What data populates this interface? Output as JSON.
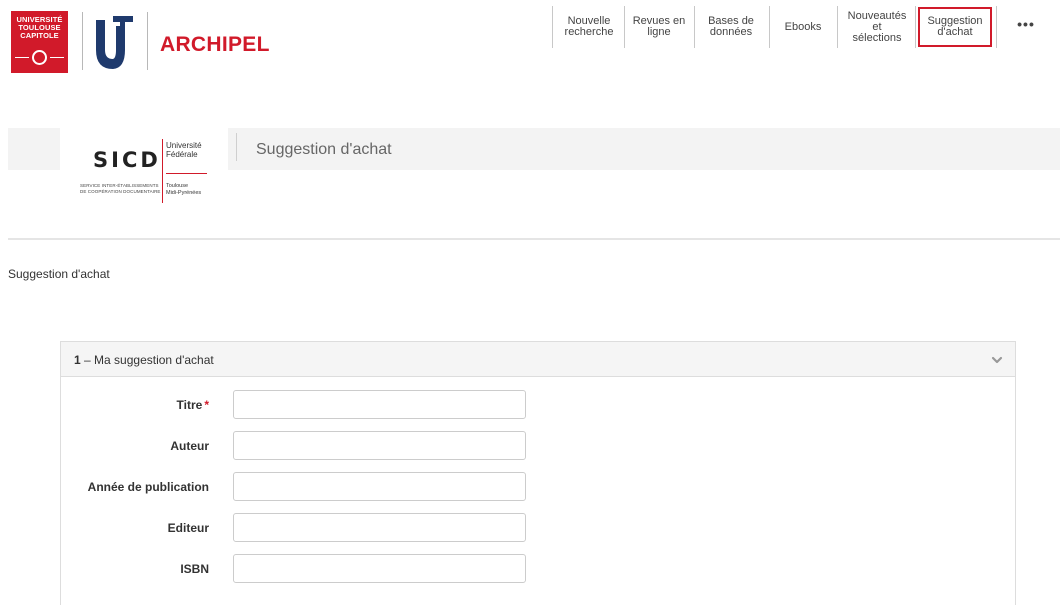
{
  "header": {
    "university_logo_text": "UNIVERSITÉ TOULOUSE CAPITOLE",
    "brand": "ARCHIPEL",
    "nav": [
      {
        "label": "Nouvelle\nrecherche",
        "active": false
      },
      {
        "label": "Revues en\nligne",
        "active": false
      },
      {
        "label": "Bases de\ndonnées",
        "active": false
      },
      {
        "label": "Ebooks",
        "active": false
      },
      {
        "label": "Nouveautés\net\nsélections",
        "active": false
      },
      {
        "label": "Suggestion\nd'achat",
        "active": true
      }
    ],
    "more_label": "•••",
    "more_icon": "more-horizontal-icon"
  },
  "banner": {
    "logo_text": "SICD",
    "logo_university": "Université\nFédérale",
    "logo_place": "Toulouse\nMidi-Pyrénées",
    "logo_service": "SERVICE INTER-ÉTABLISSEMENTS\nDE COOPÉRATION DOCUMENTAIRE",
    "title": "Suggestion d'achat"
  },
  "breadcrumb": "Suggestion d'achat",
  "panel": {
    "step": "1",
    "title": "– Ma suggestion d'achat",
    "toggle_icon": "chevron-down-icon",
    "fields": [
      {
        "label": "Titre",
        "required": true,
        "required_mark": "*",
        "value": ""
      },
      {
        "label": "Auteur",
        "required": false,
        "value": ""
      },
      {
        "label": "Année de publication",
        "required": false,
        "value": ""
      },
      {
        "label": "Editeur",
        "required": false,
        "value": ""
      },
      {
        "label": "ISBN",
        "required": false,
        "value": ""
      }
    ]
  },
  "colors": {
    "brand_red": "#d11a2a",
    "panel_header_bg": "#f5f5f5",
    "border": "#dddddd"
  }
}
